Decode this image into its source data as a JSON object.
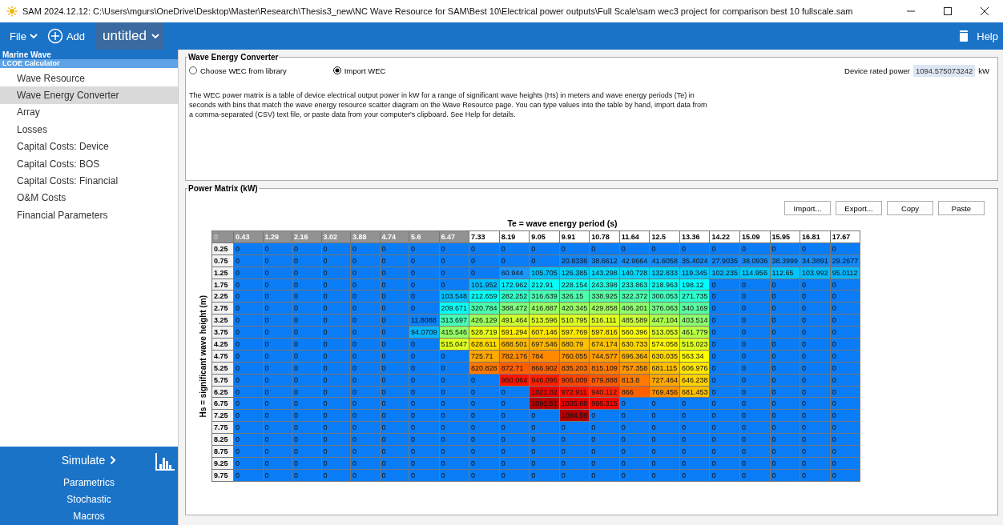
{
  "title_bar": {
    "title": "SAM 2024.12.12: C:\\Users\\mgurs\\OneDrive\\Desktop\\Master\\Research\\Thesis3_new\\NC Wave Resource for SAM\\Best 10\\Electrical power outputs\\Full Scale\\sam wec3 project for comparison best 10 fullscale.sam"
  },
  "menu": {
    "file": "File",
    "add": "Add",
    "case": "untitled",
    "help": "Help"
  },
  "sidebar": {
    "heading": "Marine Wave",
    "subheading": "LCOE Calculator",
    "items": [
      {
        "label": "Wave Resource",
        "selected": false
      },
      {
        "label": "Wave Energy Converter",
        "selected": true
      },
      {
        "label": "Array",
        "selected": false
      },
      {
        "label": "Losses",
        "selected": false
      },
      {
        "label": "Capital Costs: Device",
        "selected": false
      },
      {
        "label": "Capital Costs: BOS",
        "selected": false
      },
      {
        "label": "Capital Costs: Financial",
        "selected": false
      },
      {
        "label": "O&M Costs",
        "selected": false
      },
      {
        "label": "Financial Parameters",
        "selected": false
      }
    ]
  },
  "simulate": {
    "label": "Simulate",
    "links": [
      "Parametrics",
      "Stochastic",
      "Macros"
    ]
  },
  "wec": {
    "title": "Wave Energy Converter",
    "options": [
      {
        "label": "Choose WEC from library",
        "selected": false
      },
      {
        "label": "Import WEC",
        "selected": true
      }
    ],
    "rated_power": {
      "label": "Device rated power",
      "value": "1094.575073242",
      "unit": "kW"
    },
    "description": "The WEC power matrix is a table of device electrical output power in kW for a range of significant wave heights (Hs) in meters and wave energy periods (Te) in seconds with bins that match the wave energy resource scatter diagram on the Wave Resource page. You can type values into the table by hand, import data from a comma-separated (CSV) text file, or paste data from your computer's clipboard. See Help for details."
  },
  "power_matrix": {
    "title": "Power Matrix (kW)",
    "buttons": [
      "Import...",
      "Export...",
      "Copy",
      "Paste"
    ],
    "x_axis_title": "Te = wave energy period (s)",
    "y_axis_title": "Hs = significant wave height (m)",
    "corner": "0",
    "columns": [
      {
        "label": "0.43",
        "shaded": true
      },
      {
        "label": "1.29",
        "shaded": true
      },
      {
        "label": "2.16",
        "shaded": true
      },
      {
        "label": "3.02",
        "shaded": true
      },
      {
        "label": "3.88",
        "shaded": true
      },
      {
        "label": "4.74",
        "shaded": true
      },
      {
        "label": "5.6",
        "shaded": true
      },
      {
        "label": "6.47",
        "shaded": true
      },
      {
        "label": "7.33",
        "shaded": false
      },
      {
        "label": "8.19",
        "shaded": false
      },
      {
        "label": "9.05",
        "shaded": false
      },
      {
        "label": "9.91",
        "shaded": false
      },
      {
        "label": "10.78",
        "shaded": false
      },
      {
        "label": "11.64",
        "shaded": false
      },
      {
        "label": "12.5",
        "shaded": false
      },
      {
        "label": "13.36",
        "shaded": false
      },
      {
        "label": "14.22",
        "shaded": false
      },
      {
        "label": "15.09",
        "shaded": false
      },
      {
        "label": "15.95",
        "shaded": false
      },
      {
        "label": "16.81",
        "shaded": false
      },
      {
        "label": "17.67",
        "shaded": false
      }
    ],
    "rows": [
      {
        "hs": "0.25",
        "cells": [
          "0",
          "0",
          "0",
          "0",
          "0",
          "0",
          "0",
          "0",
          "0",
          "0",
          "0",
          "0",
          "0",
          "0",
          "0",
          "0",
          "0",
          "0",
          "0",
          "0",
          "0"
        ]
      },
      {
        "hs": "0.75",
        "cells": [
          "0",
          "0",
          "0",
          "0",
          "0",
          "0",
          "0",
          "0",
          "0",
          "0",
          "0",
          "20.8336",
          "38.6612",
          "42.9664",
          "41.6058",
          "35.4024",
          "27.9035",
          "38.0936",
          "38.3999",
          "34.3891",
          "29.2677"
        ]
      },
      {
        "hs": "1.25",
        "cells": [
          "0",
          "0",
          "0",
          "0",
          "0",
          "0",
          "0",
          "0",
          "0",
          "60.944",
          "105.705",
          "126.385",
          "143.298",
          "140.728",
          "132.833",
          "119.345",
          "102.235",
          "114.956",
          "112.65",
          "103.992",
          "95.0112"
        ]
      },
      {
        "hs": "1.75",
        "cells": [
          "0",
          "0",
          "0",
          "0",
          "0",
          "0",
          "0",
          "0",
          "101.952",
          "172.962",
          "212.91",
          "228.154",
          "243.398",
          "233.863",
          "218.963",
          "198.12",
          "0",
          "0",
          "0",
          "0",
          "0"
        ]
      },
      {
        "hs": "2.25",
        "cells": [
          "0",
          "0",
          "0",
          "0",
          "0",
          "0",
          "0",
          "103.548",
          "212.659",
          "282.252",
          "316.639",
          "326.15",
          "338.925",
          "322.372",
          "300.053",
          "271.735",
          "0",
          "0",
          "0",
          "0",
          "0"
        ]
      },
      {
        "hs": "2.75",
        "cells": [
          "0",
          "0",
          "0",
          "0",
          "0",
          "0",
          "0",
          "209.671",
          "320.784",
          "388.472",
          "416.887",
          "420.345",
          "429.858",
          "406.201",
          "376.063",
          "340.169",
          "0",
          "0",
          "0",
          "0",
          "0"
        ]
      },
      {
        "hs": "3.25",
        "cells": [
          "0",
          "0",
          "0",
          "0",
          "0",
          "0",
          "11.8088",
          "313.697",
          "426.129",
          "491.464",
          "513.596",
          "510.795",
          "516.111",
          "485.589",
          "447.104",
          "403.514",
          "0",
          "0",
          "0",
          "0",
          "0"
        ]
      },
      {
        "hs": "3.75",
        "cells": [
          "0",
          "0",
          "0",
          "0",
          "0",
          "0",
          "94.0709",
          "415.546",
          "528.719",
          "591.294",
          "607.146",
          "597.769",
          "597.816",
          "560.396",
          "513.053",
          "461.779",
          "0",
          "0",
          "0",
          "0",
          "0"
        ]
      },
      {
        "hs": "4.25",
        "cells": [
          "0",
          "0",
          "0",
          "0",
          "0",
          "0",
          "0",
          "515.047",
          "628.611",
          "688.501",
          "697.546",
          "680.79",
          "674.174",
          "630.733",
          "574.058",
          "515.023",
          "0",
          "0",
          "0",
          "0",
          "0"
        ]
      },
      {
        "hs": "4.75",
        "cells": [
          "0",
          "0",
          "0",
          "0",
          "0",
          "0",
          "0",
          "0",
          "725.71",
          "782.176",
          "784",
          "760.055",
          "744.577",
          "696.364",
          "630.035",
          "563.34",
          "0",
          "0",
          "0",
          "0",
          "0"
        ]
      },
      {
        "hs": "5.25",
        "cells": [
          "0",
          "0",
          "0",
          "0",
          "0",
          "0",
          "0",
          "0",
          "820.828",
          "872.71",
          "866.902",
          "835.203",
          "815.109",
          "757.358",
          "681.115",
          "606.976",
          "0",
          "0",
          "0",
          "0",
          "0"
        ]
      },
      {
        "hs": "5.75",
        "cells": [
          "0",
          "0",
          "0",
          "0",
          "0",
          "0",
          "0",
          "0",
          "0",
          "960.064",
          "946.096",
          "906.009",
          "879.888",
          "813.8",
          "727.464",
          "646.238",
          "0",
          "0",
          "0",
          "0",
          "0"
        ]
      },
      {
        "hs": "6.25",
        "cells": [
          "0",
          "0",
          "0",
          "0",
          "0",
          "0",
          "0",
          "0",
          "0",
          "0",
          "1021.02",
          "972.911",
          "940.112",
          "866",
          "769.456",
          "681.453",
          "0",
          "0",
          "0",
          "0",
          "0"
        ]
      },
      {
        "hs": "6.75",
        "cells": [
          "0",
          "0",
          "0",
          "0",
          "0",
          "0",
          "0",
          "0",
          "0",
          "0",
          "1091.51",
          "1035.68",
          "996.315",
          "0",
          "0",
          "0",
          "0",
          "0",
          "0",
          "0",
          "0"
        ]
      },
      {
        "hs": "7.25",
        "cells": [
          "0",
          "0",
          "0",
          "0",
          "0",
          "0",
          "0",
          "0",
          "0",
          "0",
          "0",
          "1094.58",
          "0",
          "0",
          "0",
          "0",
          "0",
          "0",
          "0",
          "0",
          "0"
        ]
      },
      {
        "hs": "7.75",
        "cells": [
          "0",
          "0",
          "0",
          "0",
          "0",
          "0",
          "0",
          "0",
          "0",
          "0",
          "0",
          "0",
          "0",
          "0",
          "0",
          "0",
          "0",
          "0",
          "0",
          "0",
          "0"
        ]
      },
      {
        "hs": "8.25",
        "cells": [
          "0",
          "0",
          "0",
          "0",
          "0",
          "0",
          "0",
          "0",
          "0",
          "0",
          "0",
          "0",
          "0",
          "0",
          "0",
          "0",
          "0",
          "0",
          "0",
          "0",
          "0"
        ]
      },
      {
        "hs": "8.75",
        "cells": [
          "0",
          "0",
          "0",
          "0",
          "0",
          "0",
          "0",
          "0",
          "0",
          "0",
          "0",
          "0",
          "0",
          "0",
          "0",
          "0",
          "0",
          "0",
          "0",
          "0",
          "0"
        ]
      },
      {
        "hs": "9.25",
        "cells": [
          "0",
          "0",
          "0",
          "0",
          "0",
          "0",
          "0",
          "0",
          "0",
          "0",
          "0",
          "0",
          "0",
          "0",
          "0",
          "0",
          "0",
          "0",
          "0",
          "0",
          "0"
        ]
      },
      {
        "hs": "9.75",
        "cells": [
          "0",
          "0",
          "0",
          "0",
          "0",
          "0",
          "0",
          "0",
          "0",
          "0",
          "0",
          "0",
          "0",
          "0",
          "0",
          "0",
          "0",
          "0",
          "0",
          "0",
          "0"
        ]
      }
    ]
  }
}
